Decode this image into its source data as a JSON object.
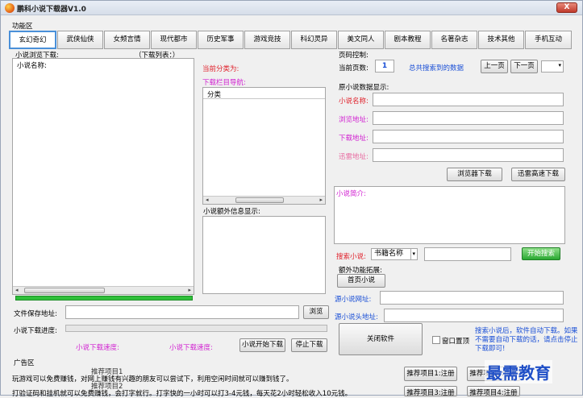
{
  "window": {
    "title": "鹏科小说下载器V1.0",
    "close": "X"
  },
  "section_func": "功能区",
  "tabs": [
    "玄幻奇幻",
    "武侠仙侠",
    "女频言情",
    "现代都市",
    "历史军事",
    "游戏竞技",
    "科幻灵异",
    "美文同人",
    "剧本教程",
    "名著杂志",
    "技术其他",
    "手机互动"
  ],
  "left": {
    "browse_label": "小说浏览下载:",
    "list_count_label": "（下载列表：）",
    "col_name": "小说名称:"
  },
  "middle": {
    "current_category": "当前分类为:",
    "nav_label": "下载栏目导航:",
    "nav_header": "分类",
    "extra_label": "小说额外信息显示:"
  },
  "page_control": {
    "label": "页码控制:",
    "current_page_label": "当前页数:",
    "current_page": "1",
    "total_label": "总共搜索到的数据",
    "prev": "上一页",
    "next": "下一页"
  },
  "source": {
    "label": "原小说数据显示:",
    "name": "小说名称:",
    "browse_url": "浏览地址:",
    "download_url": "下载地址:",
    "thunder_url": "迅雷地址:",
    "btn_browser_dl": "浏览器下载",
    "btn_thunder_dl": "迅雷高速下载",
    "intro": "小说简介:"
  },
  "search": {
    "label": "搜索小说:",
    "field": "书籍名称",
    "btn": "开始搜索"
  },
  "extra_func": {
    "label": "额外功能拓展:",
    "home_btn": "首页小说",
    "source_site": "源小说网址:",
    "source_head": "源小说头地址:",
    "close_btn": "关闭软件",
    "top_checkbox": "窗口置顶",
    "tip": "搜索小说后，软件自动下载。如果不需要自动下载的话，请点击停止下载即可!"
  },
  "save": {
    "path_label": "文件保存地址:",
    "browse_btn": "浏览",
    "progress_label": "小说下载进度:",
    "progress": 0,
    "speed_label": "小说下载速度:",
    "speed2_label": "小说下载速度:",
    "start_btn": "小说开始下载",
    "stop_btn": "停止下载"
  },
  "ads": {
    "label": "广告区",
    "line1": "玩游戏可以免费赚钱，对网上赚钱有兴趣的朋友可以尝试下，利用空闲时间就可以赚到钱了。",
    "line2": "打验证码和挂机就可以免费赚钱，会打字就行。打字快的一小时可以打3-4元钱，每天花2小时轻松收入10元钱。",
    "overlay1": "推荐项目1",
    "overlay2": "推荐项目2",
    "btn1": "推荐项目1:注册",
    "btn2": "推荐项目2:注册",
    "btn3": "推荐项目3:注册",
    "btn4": "推荐项目4:注册"
  },
  "watermark": "最需教育",
  "colors": {
    "accent": "#4a90d9",
    "red": "#e0202a",
    "magenta": "#d11fd1",
    "blue": "#1a4fd6"
  }
}
